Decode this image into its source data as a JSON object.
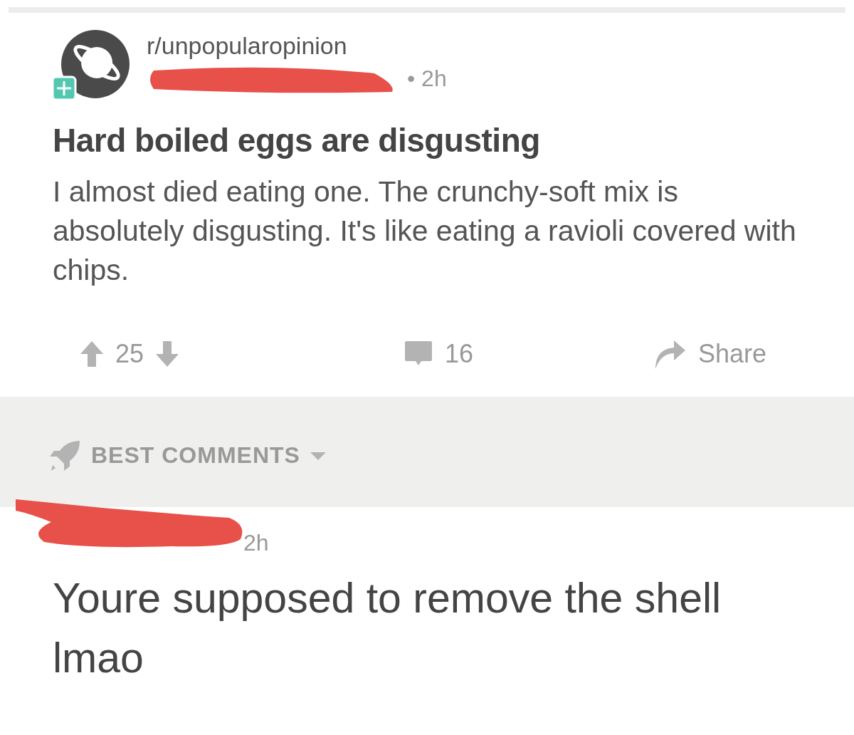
{
  "post": {
    "subreddit": "r/unpopularopinion",
    "time": "• 2h",
    "title": "Hard boiled eggs are disgusting",
    "body": "I almost died eating one. The crunchy-soft mix is absolutely disgusting. It's like eating a ravioli covered with chips.",
    "score": "25",
    "comments": "16",
    "share": "Share"
  },
  "sort": {
    "label": "BEST COMMENTS"
  },
  "comment": {
    "time": "2h",
    "text": "Youre supposed to remove the shell lmao"
  }
}
